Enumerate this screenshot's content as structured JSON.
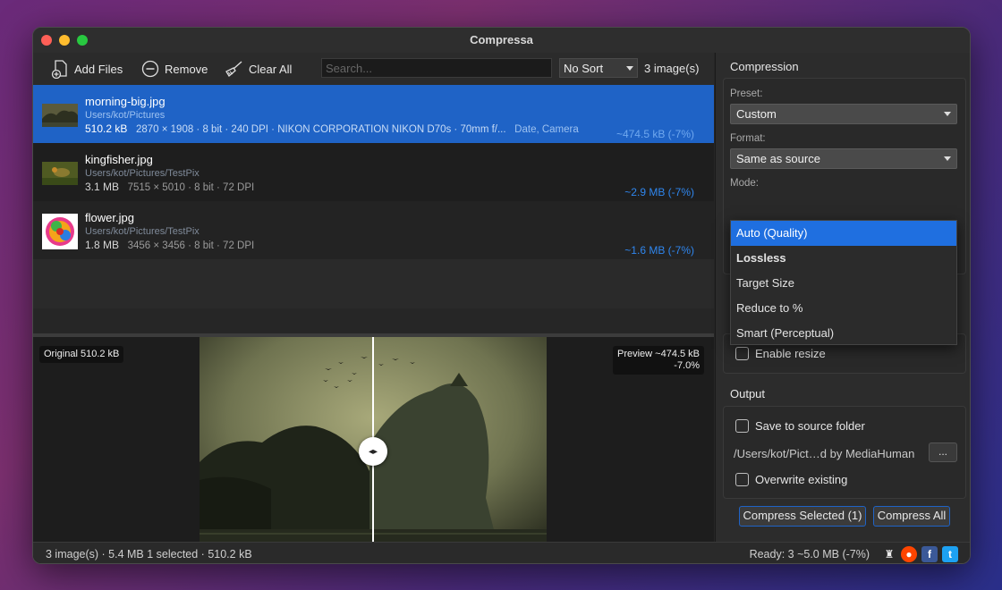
{
  "window": {
    "title": "Compressa"
  },
  "toolbar": {
    "add_files": "Add Files",
    "remove": "Remove",
    "clear_all": "Clear All",
    "search_placeholder": "Search...",
    "sort_value": "No Sort",
    "image_count": "3 image(s)"
  },
  "files": [
    {
      "name": "morning-big.jpg",
      "path": "Users/kot/Pictures",
      "size": "510.2 kB",
      "meta": "2870 × 1908  ·  8 bit  ·  240 DPI  ·  NIKON CORPORATION NIKON D70s  ·  70mm  f/...",
      "tags": "Date, Camera",
      "saving": "~474.5 kB (-7%)"
    },
    {
      "name": "kingfisher.jpg",
      "path": "Users/kot/Pictures/TestPix",
      "size": "3.1 MB",
      "meta": "7515 × 5010  ·  8 bit  ·  72 DPI",
      "tags": "",
      "saving": "~2.9 MB (-7%)"
    },
    {
      "name": "flower.jpg",
      "path": "Users/kot/Pictures/TestPix",
      "size": "1.8 MB",
      "meta": "3456 × 3456  ·  8 bit  ·  72 DPI",
      "tags": "",
      "saving": "~1.6 MB (-7%)"
    }
  ],
  "preview": {
    "original_label": "Original 510.2 kB",
    "preview_label": "Preview ~474.5 kB",
    "preview_pct": "-7.0%"
  },
  "compression": {
    "title": "Compression",
    "preset_label": "Preset:",
    "preset_value": "Custom",
    "format_label": "Format:",
    "format_value": "Same as source",
    "mode_label": "Mode:",
    "mode_options": [
      "Auto (Quality)",
      "Lossless",
      "Target Size",
      "Reduce to %",
      "Smart (Perceptual)"
    ],
    "mode_selected_index": 0,
    "enable_resize": "Enable resize"
  },
  "output": {
    "title": "Output",
    "save_to_source": "Save to source folder",
    "path": "/Users/kot/Pict…d by MediaHuman",
    "browse": "...",
    "overwrite": "Overwrite existing"
  },
  "actions": {
    "compress_selected": "Compress Selected (1)",
    "compress_all": "Compress All"
  },
  "status": {
    "left": "3 image(s) · 5.4 MB  1 selected · 510.2 kB",
    "right": "Ready: 3  ~5.0 MB (-7%)"
  },
  "colors": {
    "accent": "#1f63c6",
    "saving_text": "#2f86ee",
    "window_bg": "#262626"
  }
}
